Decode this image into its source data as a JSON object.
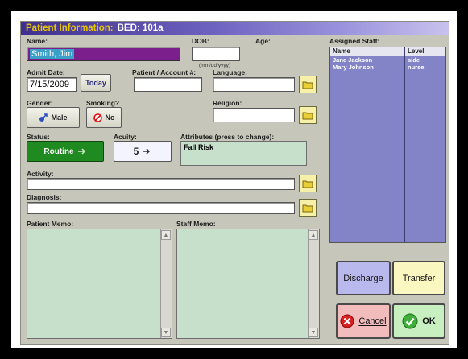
{
  "window": {
    "title": "Patient Information:",
    "bed": "BED: 101a"
  },
  "patient": {
    "name_label": "Name:",
    "name_value": "Smith, Jim",
    "dob_label": "DOB:",
    "dob_value": "",
    "dob_hint": "(mm/dd/yyyy)",
    "age_label": "Age:",
    "admit_label": "Admit Date:",
    "admit_value": "7/15/2009",
    "today_button": "Today",
    "account_label": "Patient / Account #:",
    "account_value": "",
    "language_label": "Language:",
    "language_value": "",
    "gender_label": "Gender:",
    "gender_value": "Male",
    "smoking_label": "Smoking?",
    "smoking_value": "No",
    "religion_label": "Religion:",
    "religion_value": "",
    "status_label": "Status:",
    "status_value": "Routine",
    "acuity_label": "Acuity:",
    "acuity_value": "5",
    "attributes_label": "Attributes (press to change):",
    "attributes_value": "Fall Risk",
    "activity_label": "Activity:",
    "activity_value": "",
    "diagnosis_label": "Diagnosis:",
    "diagnosis_value": "",
    "patient_memo_label": "Patient Memo:",
    "staff_memo_label": "Staff Memo:"
  },
  "staff": {
    "label": "Assigned Staff:",
    "columns": [
      "Name",
      "Level"
    ],
    "rows": [
      {
        "name": "Jane Jackson",
        "level": "aide"
      },
      {
        "name": "Mary Johnson",
        "level": "nurse"
      }
    ]
  },
  "actions": {
    "discharge": "Discharge",
    "transfer": "Transfer",
    "cancel": "Cancel",
    "ok": "OK"
  },
  "colors": {
    "title_accent": "#e8c800",
    "status_green": "#1f8a1f",
    "staff_panel": "#8383c8",
    "memo_bg": "#c6e0cc",
    "discharge_bg": "#b9b9ee",
    "transfer_bg": "#fbf7c0",
    "cancel_bg": "#f2bcbc",
    "ok_bg": "#c8efc0"
  },
  "icons": [
    "male-icon",
    "no-smoking-icon",
    "folder-icon",
    "status-toggle-icon",
    "acuity-toggle-icon",
    "cancel-icon",
    "ok-check-icon",
    "scroll-up-icon",
    "scroll-down-icon"
  ]
}
